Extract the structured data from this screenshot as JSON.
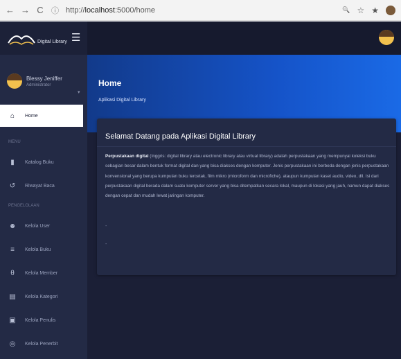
{
  "browser": {
    "back": "←",
    "forward": "→",
    "reload": "C",
    "info_icon": "ⓘ",
    "url_prefix": "http://",
    "url_host": "localhost",
    "url_path": ":5000/home",
    "zoom_icon": "🔍",
    "star_icon": "☆",
    "ext_icon": "★"
  },
  "sidebar": {
    "brand_name": "Digital Library",
    "burger_icon": "☰",
    "user": {
      "name": "Blessy Jeniffer",
      "role": "Administrator",
      "caret": "▾"
    },
    "active_item": {
      "icon": "⌂",
      "label": "Home"
    },
    "section_menu": "MENU",
    "menu_items": [
      {
        "icon": "▮",
        "label": "Katalog Buku"
      },
      {
        "icon": "↺",
        "label": "Riwayat Baca"
      }
    ],
    "section_manage": "PENGELOLAAN",
    "manage_items": [
      {
        "icon": "☻",
        "label": "Kelola User"
      },
      {
        "icon": "≡",
        "label": "Kelola Buku"
      },
      {
        "icon": "θ",
        "label": "Kelola Member"
      },
      {
        "icon": "▤",
        "label": "Kelola Kategori"
      },
      {
        "icon": "▣",
        "label": "Kelola Penulis"
      },
      {
        "icon": "◎",
        "label": "Kelola Penerbit"
      }
    ]
  },
  "hero": {
    "title": "Home",
    "subtitle": "Aplikasi Digital Library"
  },
  "card": {
    "title": "Selamat Datang pada Aplikasi Digital Library",
    "lead": "Perpustakaan digital",
    "body": " (Inggris: digital library atau electronic library atau virtual library) adalah perpustakaan yang mempunyai koleksi buku sebagian besar dalam bentuk format digital dan yang bisa diakses dengan komputer. Jenis perpustakaan ini berbeda dengan jenis perpustakaan konvensional yang berupa kumpulan buku tercetak, film mikro (microform dan microfiche), ataupun kumpulan kaset audio, video, dll. Isi dari perpustakaan digital berada dalam suatu komputer server yang bisa ditempatkan secara lokal, maupun di lokasi yang jauh, namun dapat diakses dengan cepat dan mudah lewat jaringan komputer.",
    "dot1": "-",
    "dot2": "-"
  },
  "colors": {
    "sidebar_bg": "#232a45",
    "app_bg": "#1b1f36",
    "hero_blue": "#1553c8",
    "accent_avatar": "#f2c14e"
  }
}
